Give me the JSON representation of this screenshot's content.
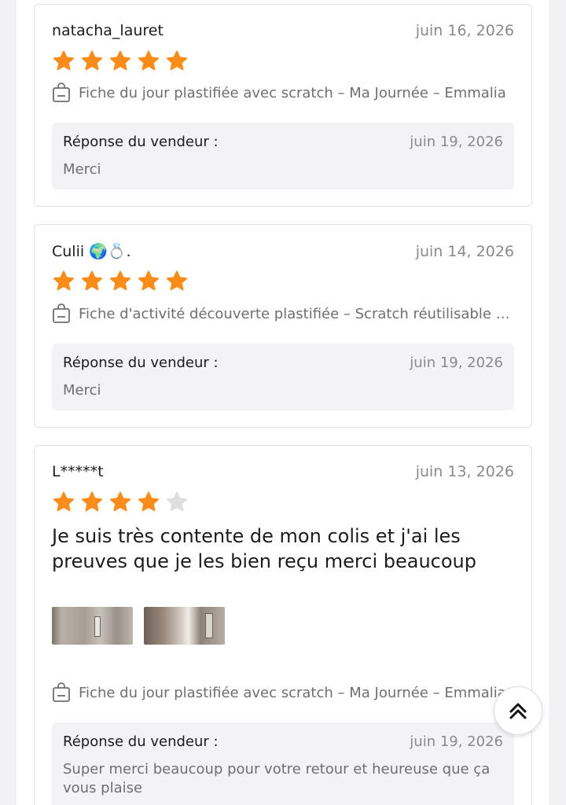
{
  "colors": {
    "star_filled": "#fb8c1a",
    "star_empty": "#dedede"
  },
  "reviews": [
    {
      "author": "natacha_lauret",
      "date": "juin 16, 2026",
      "rating": 5,
      "product": "Fiche du jour plastifiée avec scratch – Ma Journée – Emmalia",
      "reply": {
        "label": "Réponse du vendeur :",
        "date": "juin 19, 2026",
        "text": "Merci"
      }
    },
    {
      "author": "Culii 🌍💍.",
      "date": "juin 14, 2026",
      "rating": 5,
      "product": "Fiche d'activité découverte plastifiée – Scratch réutilisable –...",
      "reply": {
        "label": "Réponse du vendeur :",
        "date": "juin 19, 2026",
        "text": "Merci"
      }
    },
    {
      "author": "L*****t",
      "date": "juin 13, 2026",
      "rating": 4,
      "text": "Je suis très contente de mon colis et j'ai les preuves que je les bien reçu merci beaucoup",
      "product": "Fiche du jour plastifiée avec scratch – Ma Journée – Emmalia",
      "reply": {
        "label": "Réponse du vendeur :",
        "date": "juin 19, 2026",
        "text": "Super merci beaucoup pour votre retour et heureuse que ça vous plaise"
      }
    }
  ],
  "icons": {
    "bag": "shopping-bag-icon",
    "star": "star-icon",
    "scroll_top": "double-chevron-up-icon"
  }
}
